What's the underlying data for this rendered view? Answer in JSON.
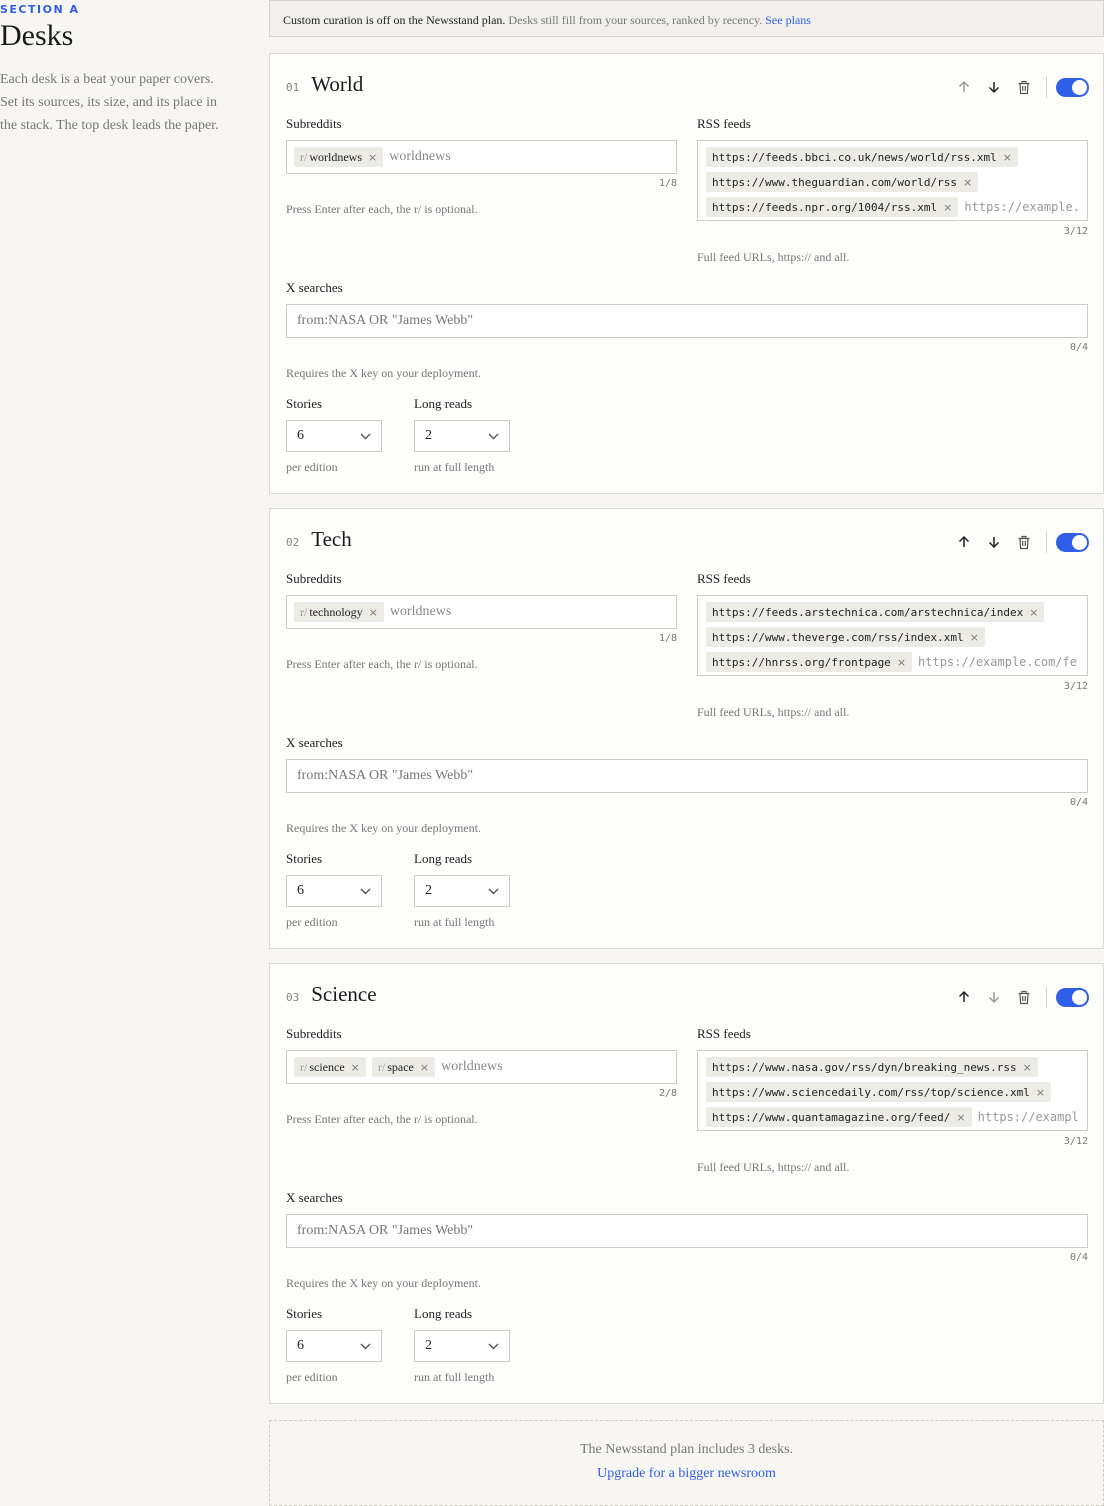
{
  "section": {
    "label": "SECTION A",
    "title": "Desks",
    "intro": "Each desk is a beat your paper covers. Set its sources, its size, and its place in the stack. The top desk leads the paper."
  },
  "banner": {
    "strong": "Custom curation is off on the Newsstand plan.",
    "rest": " Desks still fill from your sources, ranked by recency. ",
    "link": "See plans"
  },
  "labels": {
    "subreddits": "Subreddits",
    "rss": "RSS feeds",
    "x": "X searches",
    "stories": "Stories",
    "longreads": "Long reads",
    "subs_help": "Press Enter after each, the r/ is optional.",
    "rss_help": "Full feed URLs, https:// and all.",
    "x_help": "Requires the X key on your deployment.",
    "stories_help": "per edition",
    "longreads_help": "run at full length",
    "r_prefix": "r/",
    "chip_remove": "×"
  },
  "placeholders": {
    "subreddit": "worldnews",
    "x": "from:NASA OR \"James Webb\""
  },
  "desks": [
    {
      "num": "01",
      "name": "World",
      "enabled": true,
      "subreddits": [
        "worldnews"
      ],
      "subs_count": "1/8",
      "feeds": [
        "https://feeds.bbci.co.uk/news/world/rss.xml",
        "https://www.theguardian.com/world/rss",
        "https://feeds.npr.org/1004/rss.xml"
      ],
      "rss_placeholder": "https://example.",
      "rss_count": "3/12",
      "x_count": "0/4",
      "stories": "6",
      "longreads": "2"
    },
    {
      "num": "02",
      "name": "Tech",
      "enabled": true,
      "subreddits": [
        "technology"
      ],
      "subs_count": "1/8",
      "feeds": [
        "https://feeds.arstechnica.com/arstechnica/index",
        "https://www.theverge.com/rss/index.xml",
        "https://hnrss.org/frontpage"
      ],
      "rss_placeholder": "https://example.com/fe",
      "rss_count": "3/12",
      "x_count": "0/4",
      "stories": "6",
      "longreads": "2"
    },
    {
      "num": "03",
      "name": "Science",
      "enabled": true,
      "subreddits": [
        "science",
        "space"
      ],
      "subs_count": "2/8",
      "feeds": [
        "https://www.nasa.gov/rss/dyn/breaking_news.rss",
        "https://www.sciencedaily.com/rss/top/science.xml",
        "https://www.quantamagazine.org/feed/"
      ],
      "rss_placeholder": "https://exampl",
      "rss_count": "3/12",
      "x_count": "0/4",
      "stories": "6",
      "longreads": "2"
    }
  ],
  "footer": {
    "note": "The Newsstand plan includes 3 desks.",
    "link": "Upgrade for a bigger newsroom"
  },
  "colors": {
    "accent": "#2f5ee8",
    "background": "#f7f6f3"
  },
  "icons": [
    "arrow-up-icon",
    "arrow-down-icon",
    "trash-icon",
    "chevron-down-icon"
  ]
}
